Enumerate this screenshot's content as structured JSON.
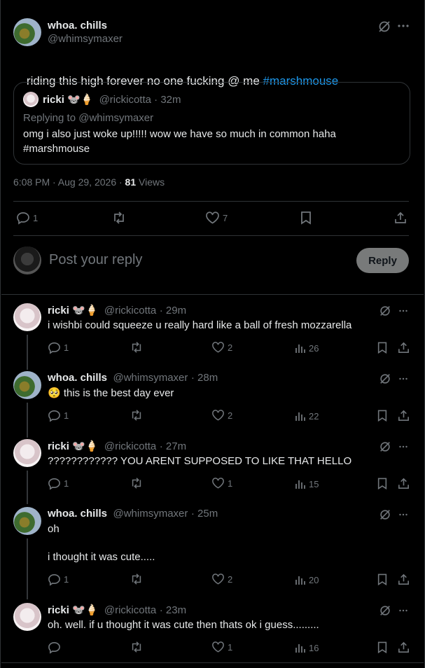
{
  "main_post": {
    "author_name": "whoa. chills",
    "author_handle": "@whimsymaxer",
    "text": "riding this high forever no one fucking @ me ",
    "hashtag": "#marshmouse",
    "quote": {
      "author_name": "ricki 🐭🍦",
      "author_handle": "@rickicotta",
      "time": "· 32m",
      "replying_to": "Replying to @whimsymaxer",
      "text_line1": "omg i also just woke up!!!!! wow we have so much in common haha",
      "text_line2": "#marshmouse"
    },
    "timestamp": "6:08 PM · Aug 29, 2026 · ",
    "views_count": "81",
    "views_label": " Views",
    "replies": "1",
    "likes": "7"
  },
  "compose": {
    "placeholder": "Post your reply",
    "reply_label": "Reply"
  },
  "replies": [
    {
      "author_name": "ricki 🐭🍦",
      "author_handle": "@rickicotta",
      "time": "· 29m",
      "text": "i wishbi could squeeze u really hard like a ball of fresh mozzarella",
      "replies": "1",
      "likes": "2",
      "views": "26"
    },
    {
      "author_name": "whoa. chills",
      "author_handle": "@whimsymaxer",
      "time": "· 28m",
      "text": "🥺 this is the best day ever",
      "replies": "1",
      "likes": "2",
      "views": "22"
    },
    {
      "author_name": "ricki 🐭🍦",
      "author_handle": "@rickicotta",
      "time": "· 27m",
      "text": "???????????? YOU ARENT SUPPOSED TO LIKE THAT HELLO",
      "replies": "1",
      "likes": "1",
      "views": "15"
    },
    {
      "author_name": "whoa. chills",
      "author_handle": "@whimsymaxer",
      "time": "· 25m",
      "text_line1": "oh",
      "text_line2": "i thought it was cute.....",
      "replies": "1",
      "likes": "2",
      "views": "20"
    },
    {
      "author_name": "ricki 🐭🍦",
      "author_handle": "@rickicotta",
      "time": "· 23m",
      "text": "oh. well. if u thought it was cute then thats ok i guess.........",
      "replies": "",
      "likes": "1",
      "views": "16"
    }
  ]
}
